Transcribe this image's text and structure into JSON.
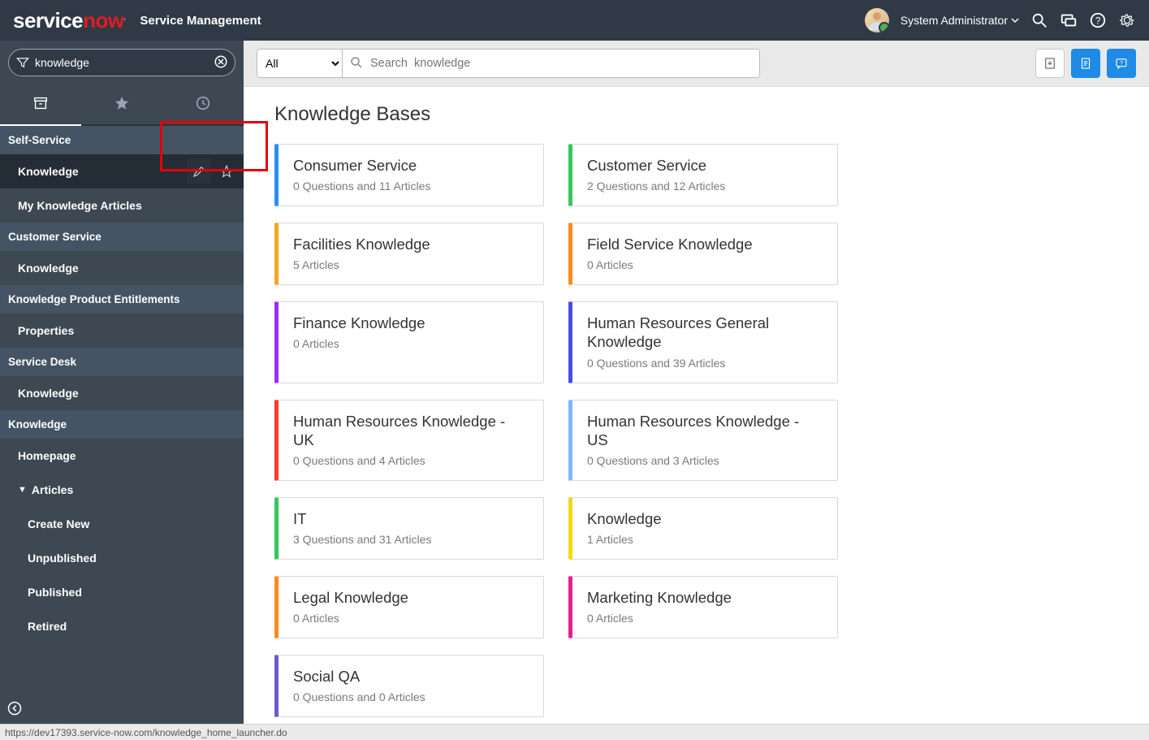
{
  "banner": {
    "logo_part1": "service",
    "logo_part2": "now",
    "logo_sup": ".",
    "app_name": "Service Management",
    "user_name": "System Administrator"
  },
  "nav": {
    "filter_value": "knowledge",
    "sections": [
      {
        "header": "Self-Service",
        "items": [
          {
            "label": "Knowledge",
            "active": true,
            "actions": true
          },
          {
            "label": "My Knowledge Articles"
          }
        ]
      },
      {
        "header": "Customer Service",
        "items": [
          {
            "label": "Knowledge"
          }
        ]
      },
      {
        "header": "Knowledge Product Entitlements",
        "items": [
          {
            "label": "Properties"
          }
        ]
      },
      {
        "header": "Service Desk",
        "items": [
          {
            "label": "Knowledge"
          }
        ]
      },
      {
        "header": "Knowledge",
        "items": [
          {
            "label": "Homepage"
          },
          {
            "label": "Articles",
            "caret": true
          },
          {
            "label": "Create New",
            "sub": true
          },
          {
            "label": "Unpublished",
            "sub": true
          },
          {
            "label": "Published",
            "sub": true
          },
          {
            "label": "Retired",
            "sub": true
          }
        ]
      }
    ]
  },
  "content": {
    "search_scope": "All",
    "search_placeholder": "Search  knowledge",
    "title": "Knowledge Bases",
    "cards": [
      {
        "title": "Consumer Service",
        "meta": "0 Questions and  11 Articles",
        "color": "#278efc"
      },
      {
        "title": "Customer Service",
        "meta": "2 Questions and  12 Articles",
        "color": "#34c759"
      },
      {
        "title": "Facilities Knowledge",
        "meta": " 5 Articles",
        "color": "#f5a623"
      },
      {
        "title": "Field Service Knowledge",
        "meta": " 0 Articles",
        "color": "#ff8c1a"
      },
      {
        "title": "Finance Knowledge",
        "meta": " 0 Articles",
        "color": "#9b30ff"
      },
      {
        "title": "Human Resources General Knowledge",
        "meta": "0 Questions and  39 Articles",
        "color": "#4a4ae6"
      },
      {
        "title": "Human Resources Knowledge - UK",
        "meta": "0 Questions and  4 Articles",
        "color": "#ff3b30"
      },
      {
        "title": "Human Resources Knowledge - US",
        "meta": "0 Questions and  3 Articles",
        "color": "#7bb8ff"
      },
      {
        "title": "IT",
        "meta": "3 Questions and  31 Articles",
        "color": "#34c759"
      },
      {
        "title": "Knowledge",
        "meta": " 1 Articles",
        "color": "#f5d90a"
      },
      {
        "title": "Legal Knowledge",
        "meta": " 0 Articles",
        "color": "#ff8c1a"
      },
      {
        "title": "Marketing Knowledge",
        "meta": " 0 Articles",
        "color": "#e91e8c"
      },
      {
        "title": "Social QA",
        "meta": "0 Questions and  0 Articles",
        "color": "#6a5acd"
      }
    ]
  },
  "status_url": "https://dev17393.service-now.com/knowledge_home_launcher.do"
}
